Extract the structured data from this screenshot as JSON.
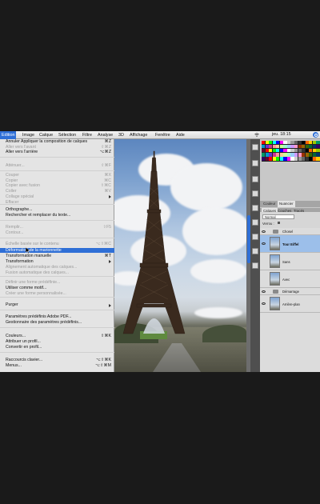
{
  "menubar": {
    "items": [
      "Edition",
      "Image",
      "Calque",
      "Sélection",
      "Filtre",
      "Analyse",
      "3D",
      "Affichage",
      "Fenêtre",
      "Aide"
    ],
    "active_index": 0,
    "clock": "jeu. 18:15"
  },
  "edit_menu": {
    "items": [
      {
        "label": "Annuler Appliquer la composition de calques",
        "shortcut": "⌘Z",
        "disabled": false
      },
      {
        "label": "Aller vers l'avant",
        "shortcut": "⇧⌘Z",
        "disabled": true
      },
      {
        "label": "Aller vers l'arrière",
        "shortcut": "⌥⌘Z",
        "disabled": false
      },
      {
        "label": "Atténuer...",
        "shortcut": "⇧⌘F",
        "disabled": true
      },
      {
        "label": "Couper",
        "shortcut": "⌘X",
        "disabled": true
      },
      {
        "label": "Copier",
        "shortcut": "⌘C",
        "disabled": true
      },
      {
        "label": "Copier avec fusion",
        "shortcut": "⇧⌘C",
        "disabled": true
      },
      {
        "label": "Coller",
        "shortcut": "⌘V",
        "disabled": true
      },
      {
        "label": "Collage spécial",
        "shortcut": "",
        "disabled": true,
        "submenu": true
      },
      {
        "label": "Effacer",
        "shortcut": "",
        "disabled": true
      },
      {
        "label": "Orthographe...",
        "shortcut": "",
        "disabled": false
      },
      {
        "label": "Rechercher et remplacer du texte...",
        "shortcut": "",
        "disabled": false
      },
      {
        "label": "Remplir...",
        "shortcut": "⇧F5",
        "disabled": true
      },
      {
        "label": "Contour...",
        "shortcut": "",
        "disabled": true
      },
      {
        "label": "Échelle basée sur le contenu",
        "shortcut": "⌥⇧⌘C",
        "disabled": true
      },
      {
        "label": "Déformation de la marionnette",
        "shortcut": "",
        "disabled": false,
        "highlight": true
      },
      {
        "label": "Transformation manuelle",
        "shortcut": "⌘T",
        "disabled": false
      },
      {
        "label": "Transformation",
        "shortcut": "",
        "disabled": false,
        "submenu": true
      },
      {
        "label": "Alignement automatique des calques...",
        "shortcut": "",
        "disabled": true
      },
      {
        "label": "Fusion automatique des calques...",
        "shortcut": "",
        "disabled": true
      },
      {
        "label": "Définir une forme prédéfinie...",
        "shortcut": "",
        "disabled": true
      },
      {
        "label": "Utiliser comme motif...",
        "shortcut": "",
        "disabled": false
      },
      {
        "label": "Créer une forme personnalisée...",
        "shortcut": "",
        "disabled": true
      },
      {
        "label": "Purger",
        "shortcut": "",
        "disabled": false,
        "submenu": true
      },
      {
        "label": "Paramètres prédéfinis Adobe PDF...",
        "shortcut": "",
        "disabled": false
      },
      {
        "label": "Gestionnaire des paramètres prédéfinis...",
        "shortcut": "",
        "disabled": false
      },
      {
        "label": "Couleurs...",
        "shortcut": "⇧⌘K",
        "disabled": false
      },
      {
        "label": "Attribuer un profil...",
        "shortcut": "",
        "disabled": false
      },
      {
        "label": "Convertir en profil...",
        "shortcut": "",
        "disabled": false
      },
      {
        "label": "Raccourcis clavier...",
        "shortcut": "⌥⇧⌘K",
        "disabled": false
      },
      {
        "label": "Menus...",
        "shortcut": "⌥⇧⌘M",
        "disabled": false
      }
    ]
  },
  "panels": {
    "tabs_top": [
      "Couleur",
      "Nuancier"
    ],
    "tabs_bottom": [
      "Calques",
      "Couches",
      "Tracés"
    ],
    "blend_mode": "Normal",
    "lock_label": "Verrou :",
    "layers": [
      {
        "name": "Chosel",
        "type": "group"
      },
      {
        "name": "Tour Eiffel",
        "type": "layer",
        "selected": true
      },
      {
        "name": "Sans",
        "type": "layer"
      },
      {
        "name": "Avec",
        "type": "layer"
      },
      {
        "name": "Démarrage",
        "type": "group"
      },
      {
        "name": "Arrière-plan",
        "type": "layer"
      }
    ]
  }
}
